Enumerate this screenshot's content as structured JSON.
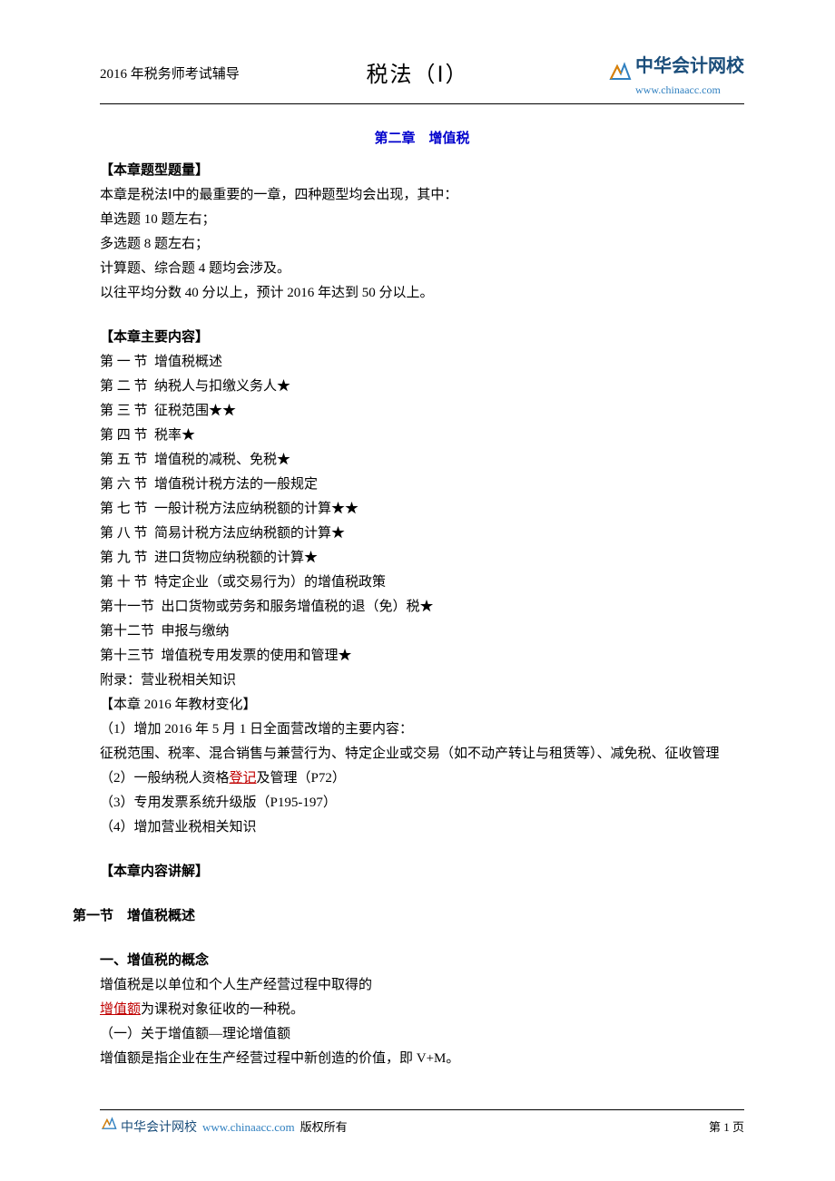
{
  "header": {
    "left": "2016 年税务师考试辅导",
    "center": "税法（Ⅰ）",
    "logo_text": "中华会计网校",
    "logo_url": "www.chinaacc.com"
  },
  "chapter": {
    "title": "第二章　增值税"
  },
  "question_types": {
    "header": "【本章题型题量】",
    "intro": "本章是税法Ⅰ中的最重要的一章，四种题型均会出现，其中：",
    "line1": "单选题 10 题左右；",
    "line2": "多选题 8 题左右；",
    "line3": "计算题、综合题 4 题均会涉及。",
    "line4": "以往平均分数 40 分以上，预计 2016 年达到 50 分以上。"
  },
  "main_content": {
    "header": "【本章主要内容】",
    "sections": [
      "第 一 节  增值税概述",
      "第 二 节  纳税人与扣缴义务人★",
      "第 三 节  征税范围★★",
      "第 四 节  税率★",
      "第 五 节  增值税的减税、免税★",
      "第 六 节  增值税计税方法的一般规定",
      "第 七 节  一般计税方法应纳税额的计算★★",
      "第 八 节  简易计税方法应纳税额的计算★",
      "第 九 节  进口货物应纳税额的计算★",
      "第 十 节  特定企业（或交易行为）的增值税政策",
      "第十一节  出口货物或劳务和服务增值税的退（免）税★",
      "第十二节  申报与缴纳",
      "第十三节  增值税专用发票的使用和管理★"
    ],
    "appendix": "附录：营业税相关知识"
  },
  "changes": {
    "header": "【本章 2016 年教材变化】",
    "item1": "（1）增加 2016 年 5 月 1 日全面营改增的主要内容：",
    "item1_detail": "　　征税范围、税率、混合销售与兼营行为、特定企业或交易（如不动产转让与租赁等）、减免税、征收管理",
    "item2_before": "（2）一般纳税人资格",
    "item2_red": "登记",
    "item2_after": "及管理（P72）",
    "item3": "（3）专用发票系统升级版（P195-197）",
    "item4": "（4）增加营业税相关知识"
  },
  "explanation": {
    "header": "【本章内容讲解】"
  },
  "node1": {
    "header": "第一节　增值税概述",
    "concept_header": "一、增值税的概念",
    "line1": "增值税是以单位和个人生产经营过程中取得的",
    "line2_red": "增值额",
    "line2_after": "为课税对象征收的一种税。",
    "line3": "（一）关于增值额—理论增值额",
    "line4": "增值额是指企业在生产经营过程中新创造的价值，即 V+M。"
  },
  "footer": {
    "logo_text": "中华会计网校",
    "url": "www.chinaacc.com",
    "copyright": "版权所有",
    "page": "第 1 页"
  }
}
